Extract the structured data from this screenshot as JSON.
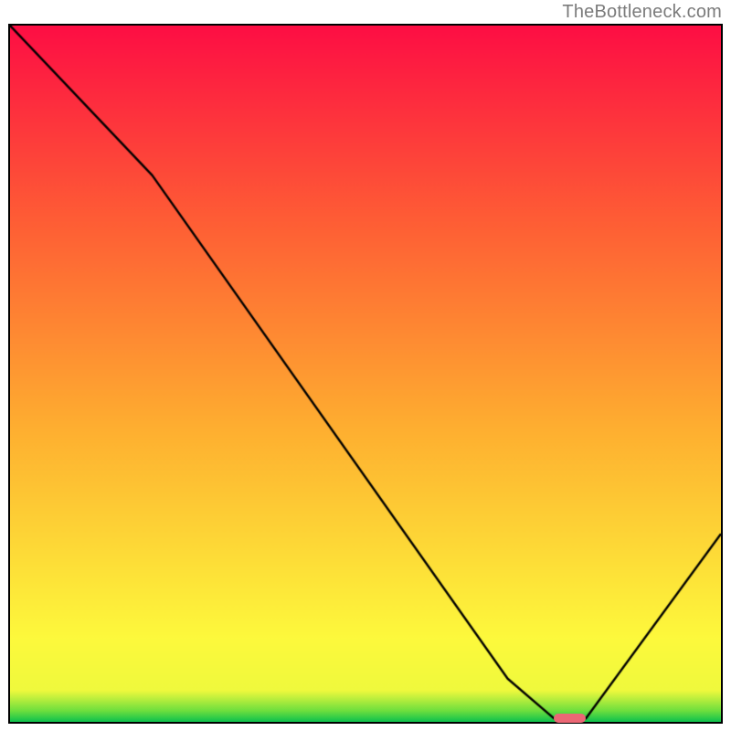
{
  "watermark": "TheBottleneck.com",
  "chart_data": {
    "type": "line",
    "title": "",
    "xlabel": "",
    "ylabel": "",
    "xlim": [
      0,
      100
    ],
    "ylim": [
      0,
      100
    ],
    "series": [
      {
        "name": "curve",
        "x": [
          0.0,
          20.0,
          70.0,
          76.5,
          81.0,
          100.0
        ],
        "values": [
          100.0,
          78.5,
          6.2,
          0.5,
          0.5,
          27.0
        ]
      }
    ],
    "optimum_marker": {
      "x_start": 76.5,
      "x_end": 81.0,
      "y": 0.5,
      "height_pct": 1.3
    },
    "gradient_stops": [
      {
        "pct": 0,
        "color": "#0dc14e"
      },
      {
        "pct": 1.6,
        "color": "#6edf3e"
      },
      {
        "pct": 4.5,
        "color": "#eff93d"
      },
      {
        "pct": 12,
        "color": "#fdf93c"
      },
      {
        "pct": 42,
        "color": "#feaf30"
      },
      {
        "pct": 72,
        "color": "#fe5d35"
      },
      {
        "pct": 100,
        "color": "#fd0e44"
      }
    ]
  }
}
